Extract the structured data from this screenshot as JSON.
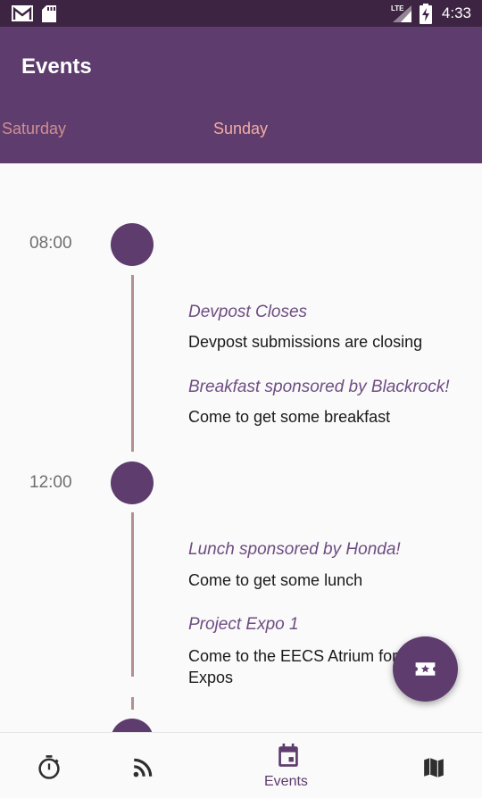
{
  "status_bar": {
    "time": "4:33",
    "network": "LTE",
    "icons": [
      "gmail-icon",
      "sd-card-icon",
      "signal-icon",
      "battery-charging-icon"
    ]
  },
  "app_bar": {
    "title": "Events",
    "tabs": [
      {
        "label": "Saturday",
        "selected": false
      },
      {
        "label": "Sunday",
        "selected": true
      }
    ]
  },
  "timeline": {
    "groups": [
      {
        "time": "08:00",
        "events": [
          {
            "title": "Devpost Closes",
            "description": "Devpost submissions are closing"
          },
          {
            "title": "Breakfast sponsored by Blackrock!",
            "description": "Come to get some breakfast"
          }
        ]
      },
      {
        "time": "12:00",
        "events": [
          {
            "title": "Lunch sponsored by Honda!",
            "description": "Come to get some lunch"
          },
          {
            "title": "Project Expo 1",
            "description": "Come to the EECS Atrium for Project Expos"
          }
        ]
      }
    ]
  },
  "fab": {
    "icon": "ticket-star-icon"
  },
  "bottom_nav": {
    "items": [
      {
        "icon": "timer-icon",
        "label": "",
        "selected": false
      },
      {
        "icon": "rss-feed-icon",
        "label": "",
        "selected": false
      },
      {
        "icon": "calendar-icon",
        "label": "Events",
        "selected": true
      },
      {
        "icon": "map-icon",
        "label": "",
        "selected": false
      }
    ]
  },
  "colors": {
    "primary": "#5e3c6d",
    "status_bar": "#3d2443",
    "accent_tab": "#f2ada2",
    "event_title": "#6e4d82",
    "timeline_line": "#b09090"
  }
}
